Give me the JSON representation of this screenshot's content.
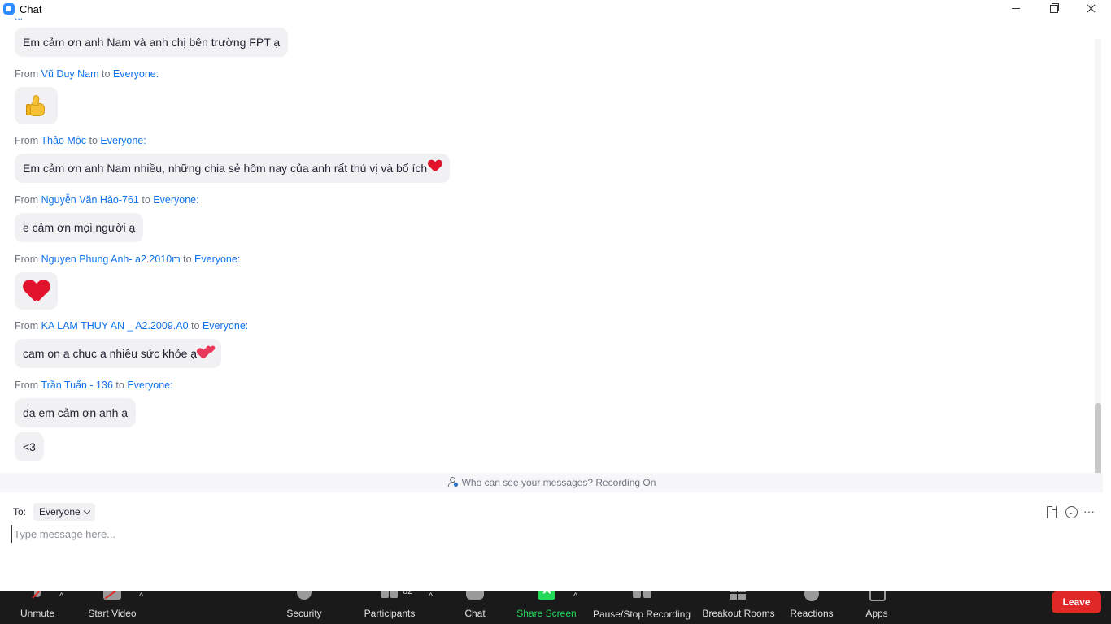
{
  "window": {
    "title": "Chat"
  },
  "chat": {
    "cut_top": "...",
    "messages": [
      {
        "text": "Em cảm ơn anh Nam và anh chị bên trường FPT ạ"
      },
      {
        "from_label": "From",
        "sender": "Vũ Duy Nam",
        "to_label": "to",
        "target": "Everyone:",
        "emoji": "thumbs-up"
      },
      {
        "from_label": "From",
        "sender": "Thảo Mộc",
        "to_label": "to",
        "target": "Everyone:",
        "text": "Em cảm ơn anh Nam nhiều, những chia sẻ hôm nay của anh rất thú vị và bổ ích",
        "emoji": "red-heart"
      },
      {
        "from_label": "From",
        "sender": "Nguyễn Văn Hào-761",
        "to_label": "to",
        "target": "Everyone:",
        "text": "e cảm ơn mọi người ạ"
      },
      {
        "from_label": "From",
        "sender": "Nguyen Phung Anh- a2.2010m",
        "to_label": "to",
        "target": "Everyone:",
        "emoji": "red-heart"
      },
      {
        "from_label": "From",
        "sender": "KA LAM THUY AN _ A2.2009.A0",
        "to_label": "to",
        "target": "Everyone:",
        "text": "cam on a chuc a nhiều sức khỏe ạ",
        "emoji": "two-hearts"
      },
      {
        "from_label": "From",
        "sender": "Trần Tuấn - 136",
        "to_label": "to",
        "target": "Everyone:",
        "text": "dạ em cảm ơn anh ạ"
      },
      {
        "text": "<3"
      }
    ]
  },
  "notice": {
    "text": "Who can see your messages? Recording On"
  },
  "compose": {
    "to_label": "To:",
    "recipient": "Everyone",
    "placeholder": "Type message here..."
  },
  "toolbar": {
    "unmute": "Unmute",
    "start_video": "Start Video",
    "security": "Security",
    "participants": "Participants",
    "participants_count": "62",
    "chat": "Chat",
    "share_screen": "Share Screen",
    "record": "Pause/Stop Recording",
    "breakout": "Breakout Rooms",
    "reactions": "Reactions",
    "apps": "Apps",
    "leave": "Leave"
  },
  "colors": {
    "accent_blue": "#0e72ed",
    "share_green": "#23d959",
    "leave_red": "#e02828",
    "toolbar_bg": "#1a1a1a",
    "bubble_bg": "#f1f1f4"
  }
}
